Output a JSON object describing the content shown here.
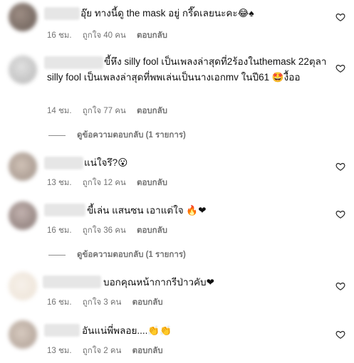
{
  "comments": [
    {
      "text": "อุ๊ย ทางนี้ดู the mask อยู่ กรี๊ดเลยนะคะ😂♠",
      "time": "16 ชม.",
      "likes": "ถูกใจ 40 คน",
      "reply": "ตอบกลับ"
    },
    {
      "text": "ขี้หึง silly fool เป็นเพลงล่าสุดที่2ร้องในthemask 22ตุลา silly fool เป็นเพลงล่าสุดที่พพเล่นเป็นนางเอกmv ในปี61 🤩งื้ออ",
      "time": "14 ชม.",
      "likes": "ถูกใจ 77 คน",
      "reply": "ตอบกลับ",
      "view_replies": "ดูข้อความตอบกลับ (1 รายการ)"
    },
    {
      "text": "แน่ใจรึ?😮",
      "time": "13 ชม.",
      "likes": "ถูกใจ 12 คน",
      "reply": "ตอบกลับ"
    },
    {
      "text": "ขี้เล่น แสนซน เอาแต่ใจ 🔥❤",
      "time": "16 ชม.",
      "likes": "ถูกใจ 36 คน",
      "reply": "ตอบกลับ",
      "view_replies": "ดูข้อความตอบกลับ (1 รายการ)"
    },
    {
      "text": "บอกคุณหน้ากากรีป่าวคับ❤",
      "time": "16 ชม.",
      "likes": "ถูกใจ 3 คน",
      "reply": "ตอบกลับ"
    },
    {
      "text": "อันแน่พี่พลอย....👏👏",
      "time": "13 ชม.",
      "likes": "ถูกใจ 2 คน",
      "reply": "ตอบกลับ"
    }
  ]
}
